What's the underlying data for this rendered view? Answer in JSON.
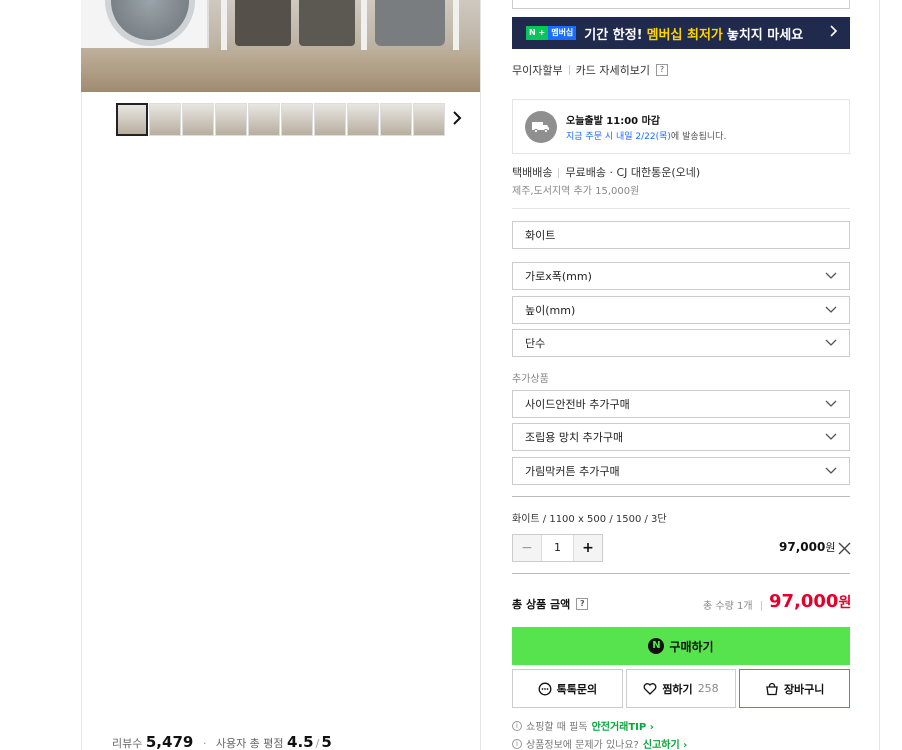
{
  "colors": {
    "banner_bg": "#1f2a4d",
    "banner_highlight": "#ffd400",
    "buy_green": "#57e34e",
    "price_red": "#e4002b",
    "delivery_blue": "#1e6bff"
  },
  "gallery": {
    "thumb_count": 10,
    "active_index": 0,
    "next_icon": "chevron-right-icon"
  },
  "reviews": {
    "count_label": "리뷰수",
    "count": "5,479",
    "rating_label": "사용자 총 평점",
    "rating": "4.5",
    "rating_sep": "/",
    "rating_max": "5"
  },
  "banner": {
    "badge_n": "N",
    "badge_plus": "+",
    "badge_text": "멤버십",
    "text_before": "기간 한정!",
    "highlight": "멤버십 최저가",
    "text_after": "놓치지 마세요"
  },
  "card_links": {
    "installment": "무이자할부",
    "card_detail": "카드 자세히보기",
    "help": "?"
  },
  "delivery": {
    "title": "오늘출발 11:00 마감",
    "sub_blue": "지금 주문 시 내일 2/22(목)",
    "sub_gray": "에 발송됩니다."
  },
  "shipping": {
    "method": "택배배송",
    "fee": "무료배송",
    "carrier": "· CJ 대한통운(오네)",
    "extra": "제주,도서지역 추가 15,000원"
  },
  "options": {
    "color": "화이트",
    "selects": [
      "가로x폭(mm)",
      "높이(mm)",
      "단수"
    ],
    "addon_label": "추가상품",
    "addons": [
      "사이드안전바 추가구매",
      "조립용 망치 추가구매",
      "가림막커튼 추가구매"
    ]
  },
  "selected": {
    "summary": "화이트 / 1100 x 500 / 1500 / 3단",
    "quantity": "1",
    "minus": "−",
    "plus": "+",
    "price": "97,000",
    "unit": "원"
  },
  "total": {
    "label": "총 상품 금액",
    "help": "?",
    "qty_text": "총 수량 1개",
    "price": "97,000",
    "unit": "원"
  },
  "buttons": {
    "buy": "구매하기",
    "buy_logo": "N",
    "talk": "톡톡문의",
    "wish": "찜하기",
    "wish_count": "258",
    "cart": "장바구니"
  },
  "tips": [
    {
      "text": "쇼핑할 때 필독",
      "link": "안전거래TIP ›"
    },
    {
      "text": "상품정보에 문제가 있나요?",
      "link": "신고하기 ›"
    }
  ]
}
